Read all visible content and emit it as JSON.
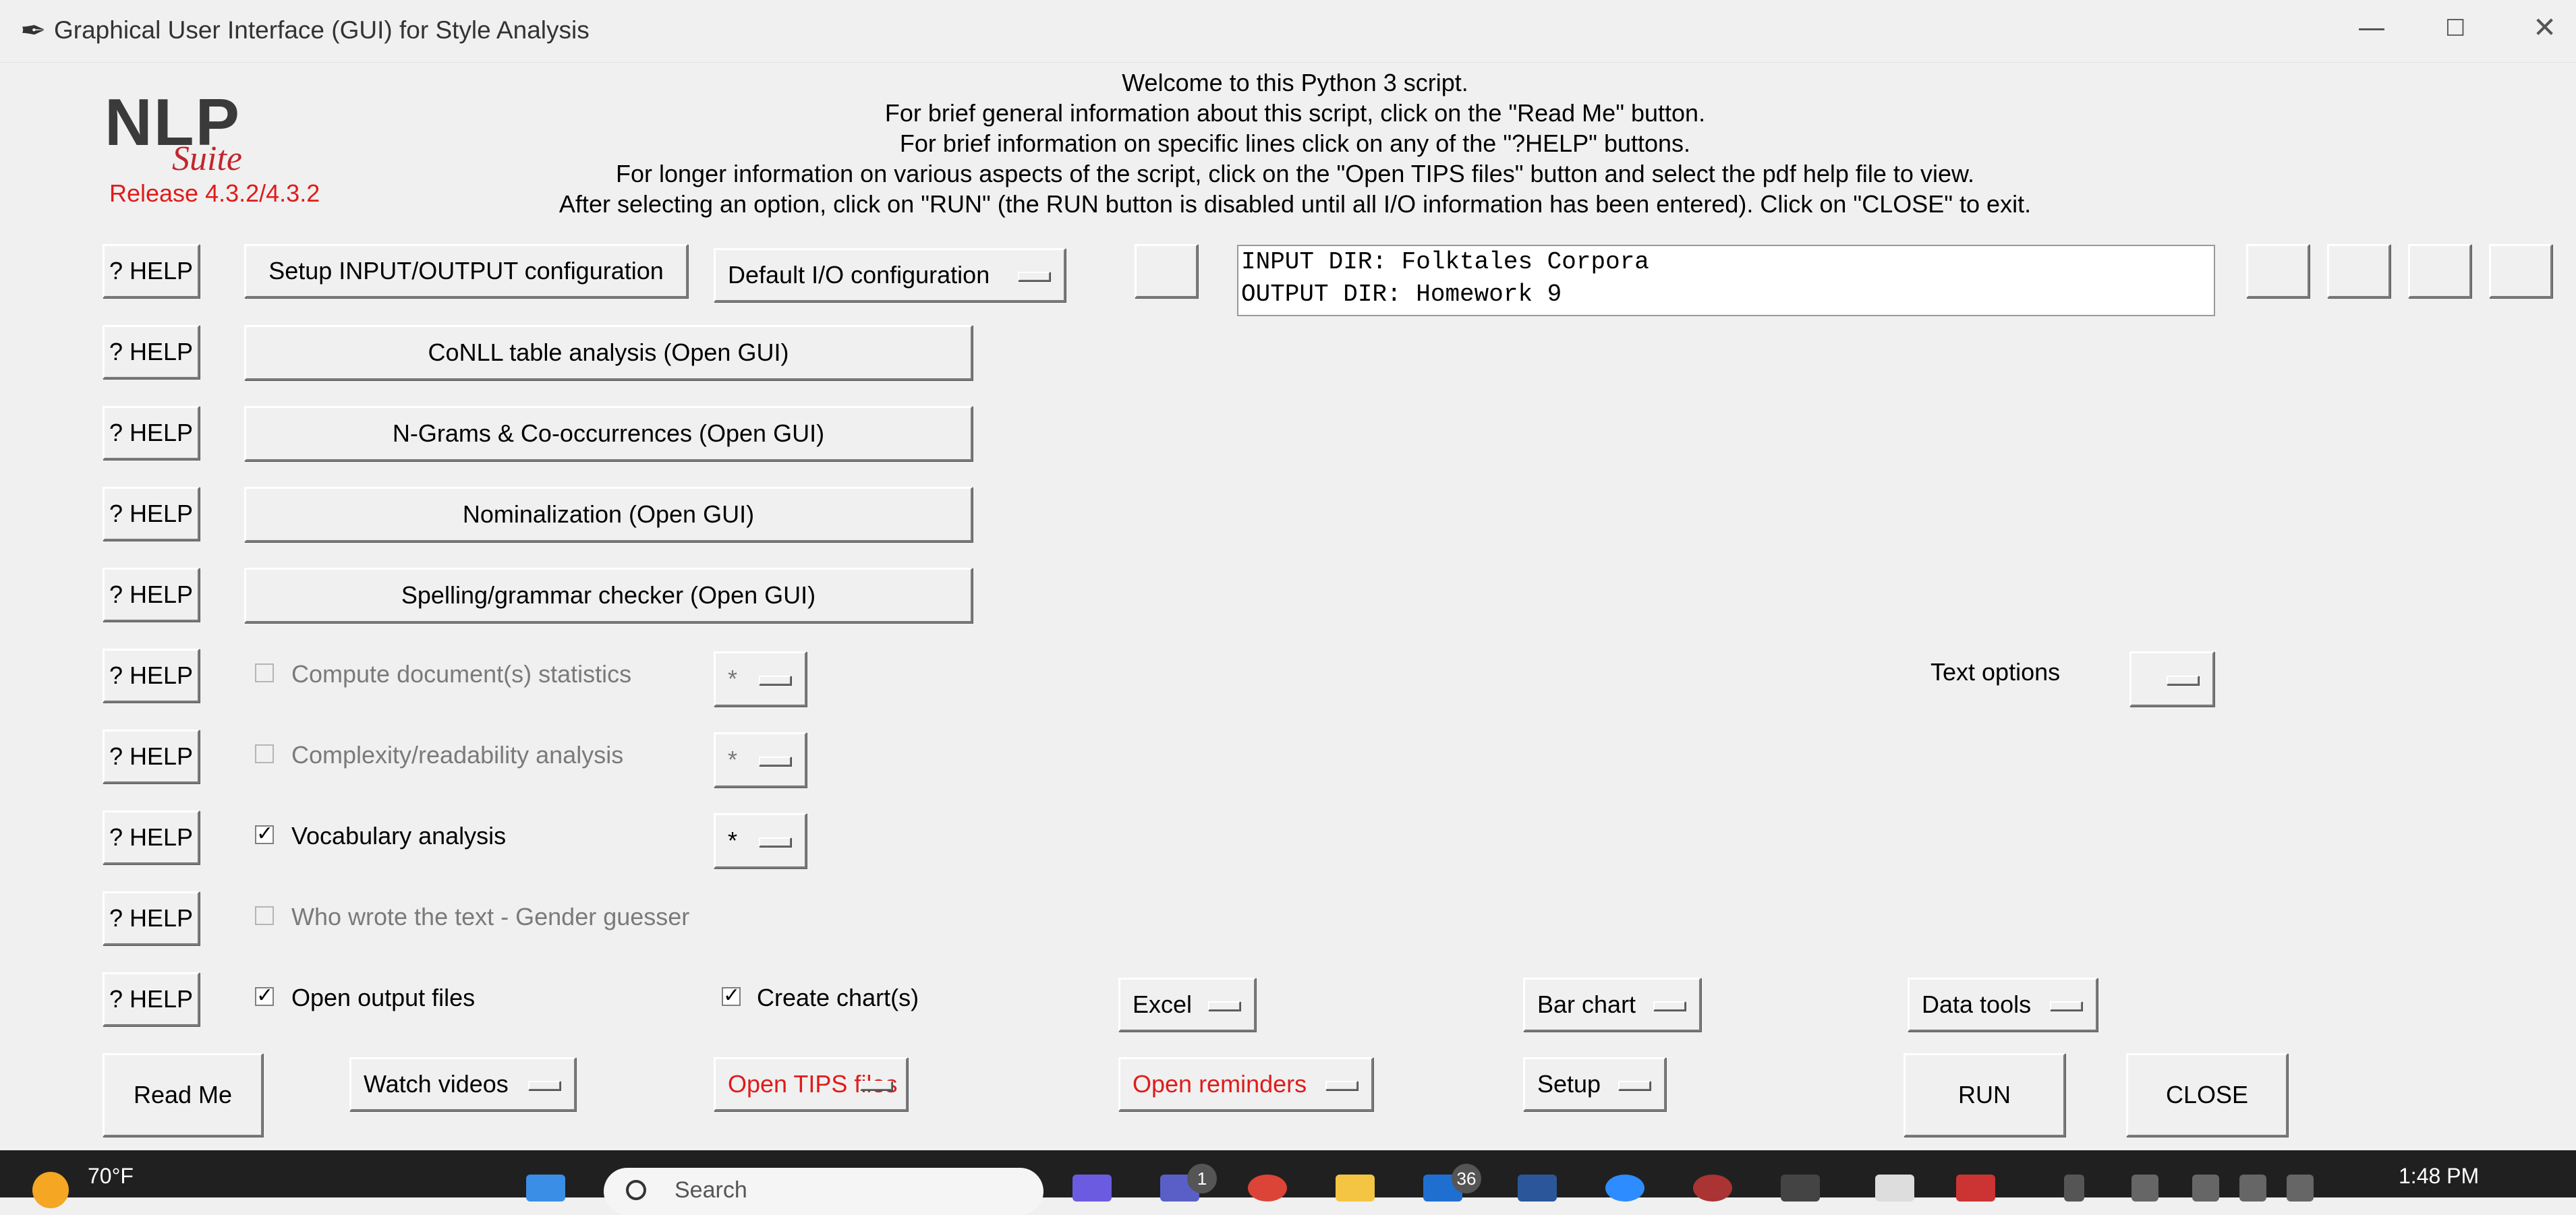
{
  "window": {
    "title": "Graphical User Interface (GUI) for Style Analysis",
    "minimize_glyph": "—",
    "maximize_glyph": "☐",
    "close_glyph": "✕",
    "app_icon": "feather-icon"
  },
  "logo": {
    "nlp": "NLP",
    "suite": "Suite",
    "release": "Release 4.3.2/4.3.2"
  },
  "welcome": [
    "Welcome to this Python 3 script.",
    "For brief general information about this script, click on the \"Read Me\" button.",
    "For brief information on specific lines click on any of the \"?HELP\" buttons.",
    "For longer information on various aspects of the script, click on the \"Open TIPS files\" button and select the pdf help file to view.",
    "After selecting an option, click on \"RUN\" (the RUN button is disabled until all I/O information has been entered).   Click on \"CLOSE\" to exit."
  ],
  "help_label": "? HELP",
  "io": {
    "setup_button": "Setup INPUT/OUTPUT configuration",
    "config_menu": "Default I/O configuration",
    "input_line": "INPUT DIR: Folktales Corpora",
    "output_line": "OUTPUT DIR: Homework 9"
  },
  "gui_buttons": [
    "CoNLL table analysis (Open GUI)",
    "N-Grams & Co-occurrences (Open GUI)",
    "Nominalization (Open GUI)",
    "Spelling/grammar checker (Open GUI)"
  ],
  "options": [
    {
      "label": "Compute document(s) statistics",
      "checked": false,
      "enabled": false,
      "menu": "*"
    },
    {
      "label": "Complexity/readability analysis",
      "checked": false,
      "enabled": false,
      "menu": "*"
    },
    {
      "label": "Vocabulary analysis",
      "checked": true,
      "enabled": true,
      "menu": "*"
    },
    {
      "label": "Who wrote the text - Gender guesser",
      "checked": false,
      "enabled": false
    }
  ],
  "text_options": {
    "label": "Text options",
    "menu": ""
  },
  "output": {
    "open_output_files": {
      "label": "Open output files",
      "checked": true
    },
    "create_charts": {
      "label": "Create chart(s)",
      "checked": true
    },
    "excel_menu": "Excel",
    "chart_type_menu": "Bar chart",
    "data_tools_menu": "Data tools"
  },
  "bottom": {
    "read_me": "Read Me",
    "watch_videos": "Watch videos",
    "open_tips": "Open TIPS files",
    "open_reminders": "Open reminders",
    "setup": "Setup",
    "run": "RUN",
    "close": "CLOSE"
  },
  "taskbar": {
    "temperature": "70°F",
    "search_placeholder": "Search",
    "teams_badge": "1",
    "mail_badge": "36",
    "time": "1:48 PM"
  },
  "colors": {
    "window_bg": "#f0f0f0",
    "logo_red": "#c0272d",
    "warning_red": "#e01b1b",
    "taskbar_bg": "#202020"
  }
}
